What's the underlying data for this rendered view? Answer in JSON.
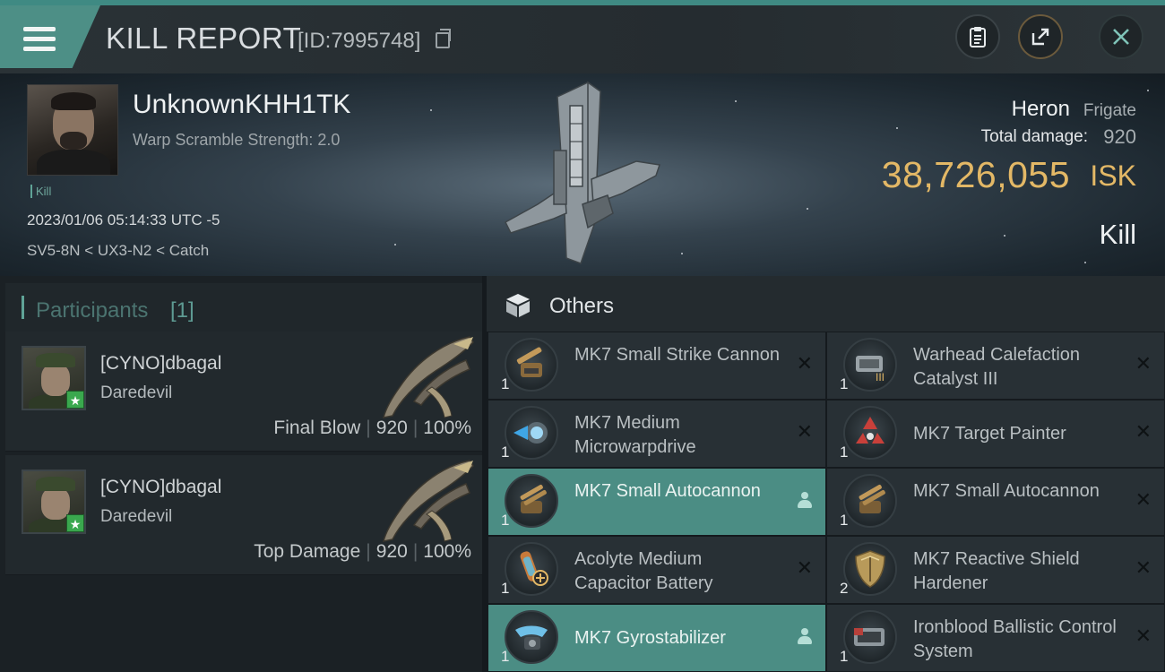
{
  "header": {
    "title": "KILL REPORT",
    "id_text": "[ID:7995748]",
    "icons": [
      "menu-icon",
      "copy-icon",
      "clipboard-icon",
      "share-icon",
      "close-icon"
    ],
    "accent_color": "#4d8f86"
  },
  "victim": {
    "name": "UnknownKHH1TK",
    "warp_scramble": "Warp Scramble Strength: 2.0",
    "tag": "Kill",
    "datetime": "2023/01/06 05:14:33 UTC -5",
    "location": "SV5-8N < UX3-N2 < Catch",
    "ship": "Heron",
    "ship_class": "Frigate",
    "total_damage_label": "Total damage:",
    "total_damage": "920",
    "isk_value": "38,726,055",
    "isk_unit": "ISK",
    "kill_type": "Kill",
    "isk_color": "#e3b866"
  },
  "participants": {
    "title": "Participants",
    "count": "[1]",
    "rows": [
      {
        "name": "[CYNO]dbagal",
        "ship": "Daredevil",
        "role": "Final Blow",
        "damage": "920",
        "percent": "100%"
      },
      {
        "name": "[CYNO]dbagal",
        "ship": "Daredevil",
        "role": "Top Damage",
        "damage": "920",
        "percent": "100%"
      }
    ]
  },
  "others": {
    "title": "Others",
    "items": [
      {
        "name": "MK7 Small Strike Cannon",
        "qty": "1",
        "status": "destroyed",
        "highlighted": false,
        "icon": "cannon-icon"
      },
      {
        "name": "Warhead Calefaction Catalyst III",
        "qty": "1",
        "status": "destroyed",
        "highlighted": false,
        "icon": "rig-icon"
      },
      {
        "name": "MK7 Medium Microwarpdrive",
        "qty": "1",
        "status": "destroyed",
        "highlighted": false,
        "icon": "microwarpdrive-icon"
      },
      {
        "name": "MK7 Target Painter",
        "qty": "1",
        "status": "destroyed",
        "highlighted": false,
        "icon": "target-painter-icon"
      },
      {
        "name": "MK7 Small Autocannon",
        "qty": "1",
        "status": "dropped",
        "highlighted": true,
        "icon": "autocannon-icon"
      },
      {
        "name": "MK7 Small Autocannon",
        "qty": "1",
        "status": "destroyed",
        "highlighted": false,
        "icon": "autocannon-icon"
      },
      {
        "name": "Acolyte Medium Capacitor Battery",
        "qty": "1",
        "status": "destroyed",
        "highlighted": false,
        "icon": "capacitor-battery-icon"
      },
      {
        "name": "MK7 Reactive Shield Hardener",
        "qty": "2",
        "status": "destroyed",
        "highlighted": false,
        "icon": "shield-hardener-icon"
      },
      {
        "name": "MK7 Gyrostabilizer",
        "qty": "1",
        "status": "dropped",
        "highlighted": true,
        "icon": "gyrostabilizer-icon"
      },
      {
        "name": "Ironblood Ballistic Control System",
        "qty": "1",
        "status": "destroyed",
        "highlighted": false,
        "icon": "ballistic-control-icon"
      }
    ]
  }
}
